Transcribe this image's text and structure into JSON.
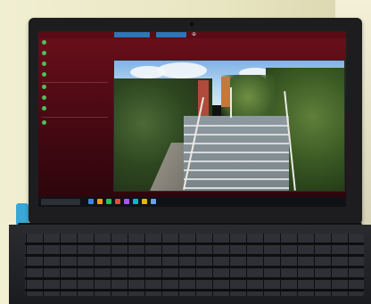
{
  "screen": {
    "topbar": {
      "chip1": "",
      "chip2": "",
      "glyph": "⊕"
    },
    "panel": {
      "metrics": [
        {
          "icon": "green-dot-icon",
          "label": "",
          "value": ""
        },
        {
          "icon": "green-dot-icon",
          "label": "",
          "value": ""
        },
        {
          "icon": "green-dot-icon",
          "label": "",
          "value": ""
        },
        {
          "icon": "green-dot-icon",
          "label": "",
          "value": ""
        },
        {
          "icon": "green-dot-icon",
          "label": "",
          "value": ""
        },
        {
          "icon": "green-dot-icon",
          "label": "",
          "value": ""
        },
        {
          "icon": "green-dot-icon",
          "label": "",
          "value": ""
        },
        {
          "icon": "green-dot-icon",
          "label": "",
          "value": ""
        }
      ],
      "table": {
        "rows": [
          [
            "",
            "",
            "",
            ""
          ],
          [
            "",
            "",
            "",
            ""
          ],
          [
            "",
            "",
            "",
            ""
          ],
          [
            "",
            "",
            "",
            ""
          ],
          [
            "",
            "",
            "",
            ""
          ],
          [
            "",
            "",
            "",
            ""
          ],
          [
            "",
            "",
            "",
            ""
          ]
        ]
      }
    },
    "taskbar": {
      "search_text": "",
      "tray_time": "",
      "tray_date": "",
      "icons": [
        "#3b82f6",
        "#f59e0b",
        "#22c55e",
        "#ef4444",
        "#a855f7",
        "#06b6d4",
        "#eab308",
        "#60a5fa"
      ]
    }
  },
  "device": {
    "brand": ""
  },
  "colors": {
    "desktop": "#6a0f1b",
    "taskbar": "#0f1116",
    "accent": "#2b77b8",
    "wall": "#ece9c8"
  }
}
